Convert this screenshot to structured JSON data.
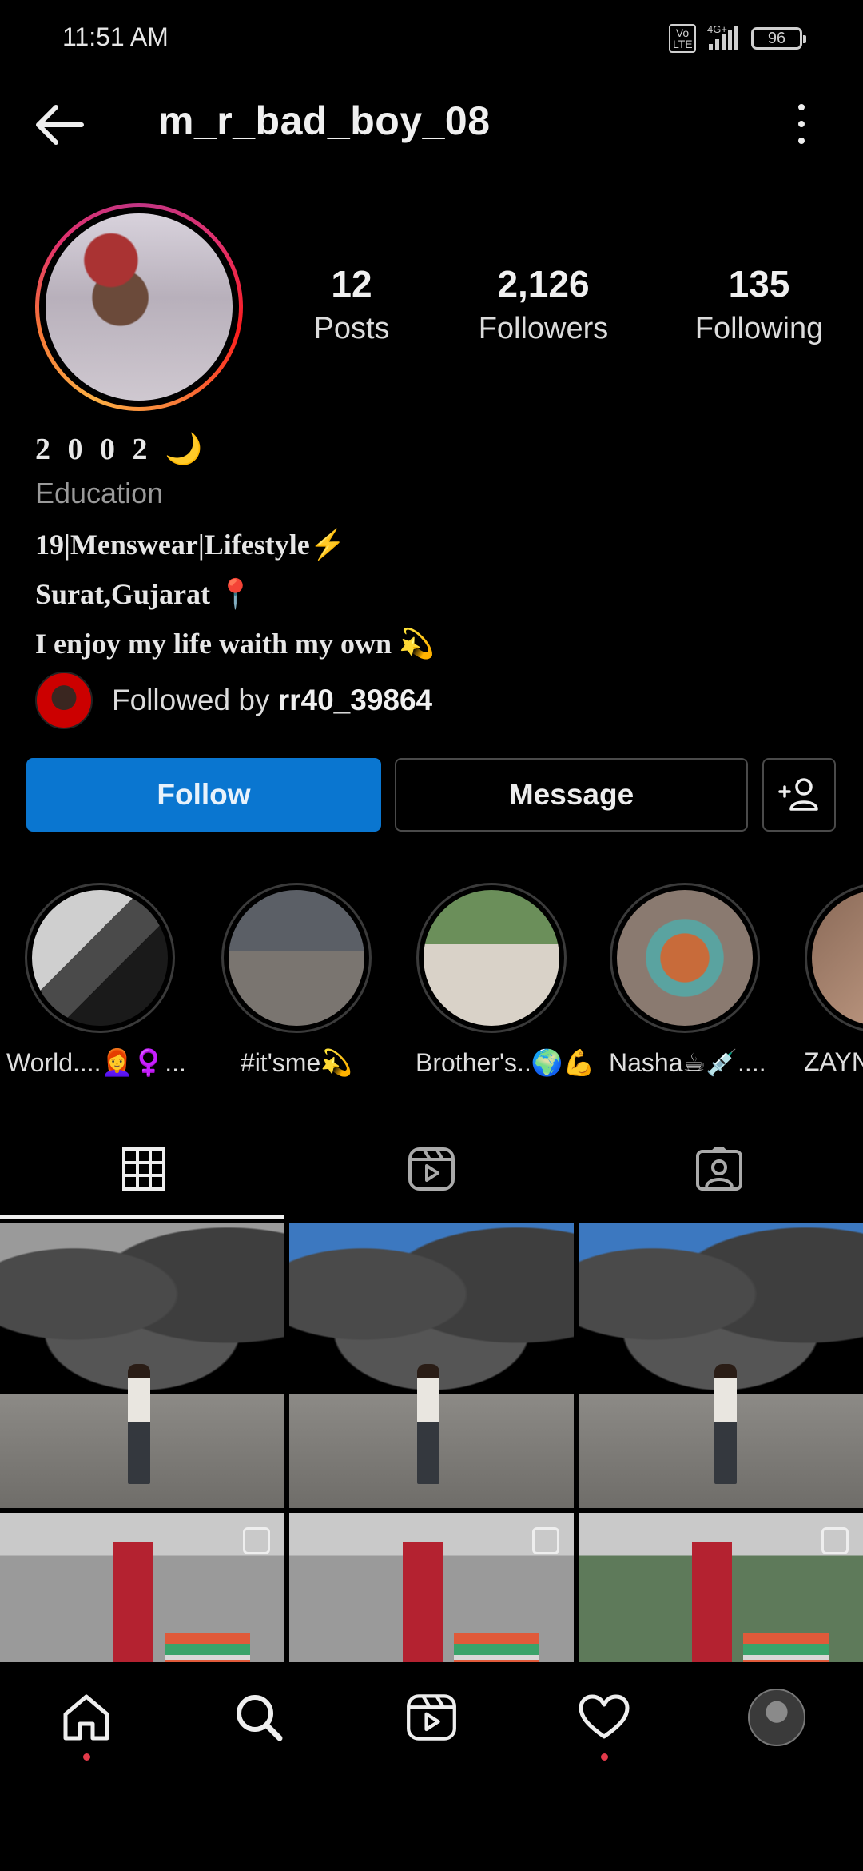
{
  "status_bar": {
    "time": "11:51 AM",
    "volte": "Vo LTE",
    "network": "4G+",
    "battery": "96"
  },
  "header": {
    "username": "m_r_bad_boy_08"
  },
  "stats": [
    {
      "value": "12",
      "label": "Posts"
    },
    {
      "value": "2,126",
      "label": "Followers"
    },
    {
      "value": "135",
      "label": "Following"
    }
  ],
  "bio": {
    "name": "2 0 0 2 🌙",
    "category": "Education",
    "lines": [
      "19|Menswear|Lifestyle⚡",
      "Surat,Gujarat 📍",
      "I enjoy my life waith my own 💫"
    ]
  },
  "followed_by": {
    "prefix": "Followed by ",
    "user": "rr40_39864"
  },
  "buttons": {
    "follow": "Follow",
    "message": "Message"
  },
  "highlights": [
    {
      "label": "World....👩‍🦰♀️..."
    },
    {
      "label": "#it'sme💫"
    },
    {
      "label": "Brother's..🌍💪"
    },
    {
      "label": "Nasha☕💉...."
    },
    {
      "label": "ZAYN"
    }
  ],
  "bottom_nav": [
    "home",
    "search",
    "reels",
    "activity",
    "profile"
  ]
}
